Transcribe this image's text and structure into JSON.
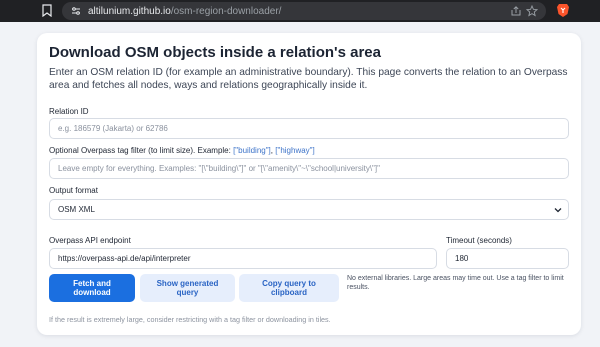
{
  "browser": {
    "url_host": "altilunium.github.io",
    "url_path": "/osm-region-downloader/"
  },
  "page": {
    "title": "Download OSM objects inside a relation's area",
    "subtitle": "Enter an OSM relation ID (for example an administrative boundary). This page converts the relation to an Overpass area and fetches all nodes, ways and relations geographically inside it."
  },
  "form": {
    "relation_label": "Relation ID",
    "relation_placeholder": "e.g. 186579 (Jakarta) or 62786",
    "filter_label_prefix": "Optional Overpass tag filter (to limit size). Example:",
    "filter_example_1": "[\"building\"]",
    "filter_example_sep": ",",
    "filter_example_2": "[\"highway\"]",
    "filter_placeholder": "Leave empty for everything. Examples: \"[\\\"building\\\"]\" or \"[\\\"amenity\\\"~\\\"school|university\\\"]\"",
    "format_label": "Output format",
    "format_selected": "OSM XML",
    "endpoint_label": "Overpass API endpoint",
    "endpoint_value": "https://overpass-api.de/api/interpreter",
    "timeout_label": "Timeout (seconds)",
    "timeout_value": "180"
  },
  "actions": {
    "fetch_label": "Fetch and download",
    "show_query_label": "Show generated query",
    "copy_query_label": "Copy query to clipboard",
    "note": "No external libraries. Large areas may time out. Use a tag filter to limit results."
  },
  "footer": {
    "note": "If the result is extremely large, consider restricting with a tag filter or downloading in tiles."
  },
  "colors": {
    "primary": "#1b6fe0",
    "secondary_bg": "#e6eefc",
    "accent_text": "#3e74c9"
  }
}
